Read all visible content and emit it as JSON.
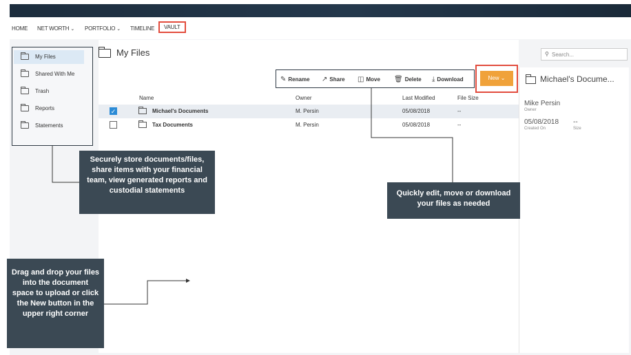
{
  "nav": {
    "home": "HOME",
    "net_worth": "NET WORTH",
    "portfolio": "PORTFOLIO",
    "timeline": "TIMELINE",
    "vault": "VAULT",
    "chevron": "⌄"
  },
  "sidebar": {
    "items": [
      {
        "label": "My Files"
      },
      {
        "label": "Shared With Me"
      },
      {
        "label": "Trash"
      },
      {
        "label": "Reports"
      },
      {
        "label": "Statements"
      }
    ]
  },
  "page": {
    "title": "My Files"
  },
  "search": {
    "placeholder": "Search..."
  },
  "toolbar": {
    "rename": "Rename",
    "share": "Share",
    "move": "Move",
    "delete": "Delete",
    "download": "Download",
    "new": "New"
  },
  "table": {
    "headers": {
      "name": "Name",
      "owner": "Owner",
      "modified": "Last Modified",
      "size": "File Size"
    },
    "rows": [
      {
        "name": "Michael's Documents",
        "owner": "M. Persin",
        "modified": "05/08/2018",
        "size": "--",
        "selected": true
      },
      {
        "name": "Tax Documents",
        "owner": "M. Persin",
        "modified": "05/08/2018",
        "size": "--",
        "selected": false
      }
    ]
  },
  "detail": {
    "title": "Michael's Docume...",
    "owner_name": "Mike Persin",
    "owner_label": "Owner",
    "created": "05/08/2018",
    "created_label": "Created On",
    "size": "--",
    "size_label": "Size"
  },
  "callouts": {
    "store": "Securely store documents/files, share items with your financial team, view generated reports and custodial statements",
    "edit": "Quickly edit, move or download your files as needed",
    "drag": "Drag and drop your files into the document space to upload or click the New button in the upper right corner"
  },
  "colors": {
    "accent_orange": "#f0a23a",
    "highlight_red": "#e24b3c",
    "callout_bg": "#3b4954",
    "topbar": "#1c2d3d",
    "checkbox_blue": "#2b8bd6"
  }
}
